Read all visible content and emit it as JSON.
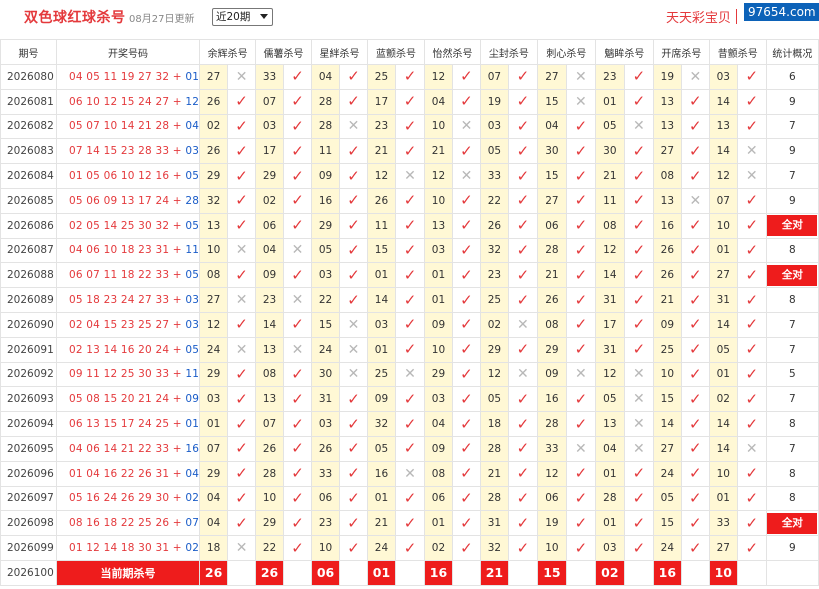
{
  "header": {
    "title": "双色球红球杀号",
    "updated": "08月27日更新",
    "range_select": "近20期",
    "brand": "天天彩宝贝",
    "watermark": "97654.com"
  },
  "table": {
    "columns": [
      "期号",
      "开奖号码",
      "余辉杀号",
      "儒薯杀号",
      "星絆杀号",
      "蓝颤杀号",
      "怡然杀号",
      "尘封杀号",
      "刺心杀号",
      "魑眸杀号",
      "开席杀号",
      "昔颤杀号",
      "统计概况"
    ],
    "rows": [
      {
        "period": "2026080",
        "red": "04 05 11 19 27 32",
        "blue": "01",
        "kills": [
          [
            "27",
            "x"
          ],
          [
            "33",
            "v"
          ],
          [
            "04",
            "v"
          ],
          [
            "25",
            "v"
          ],
          [
            "12",
            "v"
          ],
          [
            "07",
            "v"
          ],
          [
            "27",
            "x"
          ],
          [
            "23",
            "v"
          ],
          [
            "19",
            "x"
          ],
          [
            "03",
            "v"
          ]
        ],
        "stat": "6"
      },
      {
        "period": "2026081",
        "red": "06 10 12 15 24 27",
        "blue": "12",
        "kills": [
          [
            "26",
            "v"
          ],
          [
            "07",
            "v"
          ],
          [
            "28",
            "v"
          ],
          [
            "17",
            "v"
          ],
          [
            "04",
            "v"
          ],
          [
            "19",
            "v"
          ],
          [
            "15",
            "x"
          ],
          [
            "01",
            "v"
          ],
          [
            "13",
            "v"
          ],
          [
            "14",
            "v"
          ]
        ],
        "stat": "9"
      },
      {
        "period": "2026082",
        "red": "05 07 10 14 21 28",
        "blue": "04",
        "kills": [
          [
            "02",
            "v"
          ],
          [
            "03",
            "v"
          ],
          [
            "28",
            "x"
          ],
          [
            "23",
            "v"
          ],
          [
            "10",
            "x"
          ],
          [
            "03",
            "v"
          ],
          [
            "04",
            "v"
          ],
          [
            "05",
            "x"
          ],
          [
            "13",
            "v"
          ],
          [
            "13",
            "v"
          ]
        ],
        "stat": "7"
      },
      {
        "period": "2026083",
        "red": "07 14 15 23 28 33",
        "blue": "03",
        "kills": [
          [
            "26",
            "v"
          ],
          [
            "17",
            "v"
          ],
          [
            "11",
            "v"
          ],
          [
            "21",
            "v"
          ],
          [
            "21",
            "v"
          ],
          [
            "05",
            "v"
          ],
          [
            "30",
            "v"
          ],
          [
            "30",
            "v"
          ],
          [
            "27",
            "v"
          ],
          [
            "14",
            "x"
          ]
        ],
        "stat": "9"
      },
      {
        "period": "2026084",
        "red": "01 05 06 10 12 16",
        "blue": "05",
        "kills": [
          [
            "29",
            "v"
          ],
          [
            "29",
            "v"
          ],
          [
            "09",
            "v"
          ],
          [
            "12",
            "x"
          ],
          [
            "12",
            "x"
          ],
          [
            "33",
            "v"
          ],
          [
            "15",
            "v"
          ],
          [
            "21",
            "v"
          ],
          [
            "08",
            "v"
          ],
          [
            "12",
            "x"
          ]
        ],
        "stat": "7"
      },
      {
        "period": "2026085",
        "red": "05 06 09 13 17 24",
        "blue": "28",
        "kills": [
          [
            "32",
            "v"
          ],
          [
            "02",
            "v"
          ],
          [
            "16",
            "v"
          ],
          [
            "26",
            "v"
          ],
          [
            "10",
            "v"
          ],
          [
            "22",
            "v"
          ],
          [
            "27",
            "v"
          ],
          [
            "11",
            "v"
          ],
          [
            "13",
            "x"
          ],
          [
            "07",
            "v"
          ]
        ],
        "stat": "9"
      },
      {
        "period": "2026086",
        "red": "02 05 14 25 30 32",
        "blue": "05",
        "kills": [
          [
            "13",
            "v"
          ],
          [
            "06",
            "v"
          ],
          [
            "29",
            "v"
          ],
          [
            "11",
            "v"
          ],
          [
            "13",
            "v"
          ],
          [
            "26",
            "v"
          ],
          [
            "06",
            "v"
          ],
          [
            "08",
            "v"
          ],
          [
            "16",
            "v"
          ],
          [
            "10",
            "v"
          ]
        ],
        "stat": "全对"
      },
      {
        "period": "2026087",
        "red": "04 06 10 18 23 31",
        "blue": "11",
        "kills": [
          [
            "10",
            "x"
          ],
          [
            "04",
            "x"
          ],
          [
            "05",
            "v"
          ],
          [
            "15",
            "v"
          ],
          [
            "03",
            "v"
          ],
          [
            "32",
            "v"
          ],
          [
            "28",
            "v"
          ],
          [
            "12",
            "v"
          ],
          [
            "26",
            "v"
          ],
          [
            "01",
            "v"
          ]
        ],
        "stat": "8"
      },
      {
        "period": "2026088",
        "red": "06 07 11 18 22 33",
        "blue": "05",
        "kills": [
          [
            "08",
            "v"
          ],
          [
            "09",
            "v"
          ],
          [
            "03",
            "v"
          ],
          [
            "01",
            "v"
          ],
          [
            "01",
            "v"
          ],
          [
            "23",
            "v"
          ],
          [
            "21",
            "v"
          ],
          [
            "14",
            "v"
          ],
          [
            "26",
            "v"
          ],
          [
            "27",
            "v"
          ]
        ],
        "stat": "全对"
      },
      {
        "period": "2026089",
        "red": "05 18 23 24 27 33",
        "blue": "03",
        "kills": [
          [
            "27",
            "x"
          ],
          [
            "23",
            "x"
          ],
          [
            "22",
            "v"
          ],
          [
            "14",
            "v"
          ],
          [
            "01",
            "v"
          ],
          [
            "25",
            "v"
          ],
          [
            "26",
            "v"
          ],
          [
            "31",
            "v"
          ],
          [
            "21",
            "v"
          ],
          [
            "31",
            "v"
          ]
        ],
        "stat": "8"
      },
      {
        "period": "2026090",
        "red": "02 04 15 23 25 27",
        "blue": "03",
        "kills": [
          [
            "12",
            "v"
          ],
          [
            "14",
            "v"
          ],
          [
            "15",
            "x"
          ],
          [
            "03",
            "v"
          ],
          [
            "09",
            "v"
          ],
          [
            "02",
            "x"
          ],
          [
            "08",
            "v"
          ],
          [
            "17",
            "v"
          ],
          [
            "09",
            "v"
          ],
          [
            "14",
            "v"
          ]
        ],
        "stat": "7"
      },
      {
        "period": "2026091",
        "red": "02 13 14 16 20 24",
        "blue": "05",
        "kills": [
          [
            "24",
            "x"
          ],
          [
            "13",
            "x"
          ],
          [
            "24",
            "x"
          ],
          [
            "01",
            "v"
          ],
          [
            "10",
            "v"
          ],
          [
            "29",
            "v"
          ],
          [
            "29",
            "v"
          ],
          [
            "31",
            "v"
          ],
          [
            "25",
            "v"
          ],
          [
            "05",
            "v"
          ]
        ],
        "stat": "7"
      },
      {
        "period": "2026092",
        "red": "09 11 12 25 30 33",
        "blue": "11",
        "kills": [
          [
            "29",
            "v"
          ],
          [
            "08",
            "v"
          ],
          [
            "30",
            "x"
          ],
          [
            "25",
            "x"
          ],
          [
            "29",
            "v"
          ],
          [
            "12",
            "x"
          ],
          [
            "09",
            "x"
          ],
          [
            "12",
            "x"
          ],
          [
            "10",
            "v"
          ],
          [
            "01",
            "v"
          ]
        ],
        "stat": "5"
      },
      {
        "period": "2026093",
        "red": "05 08 15 20 21 24",
        "blue": "09",
        "kills": [
          [
            "03",
            "v"
          ],
          [
            "13",
            "v"
          ],
          [
            "31",
            "v"
          ],
          [
            "09",
            "v"
          ],
          [
            "03",
            "v"
          ],
          [
            "05",
            "v"
          ],
          [
            "16",
            "v"
          ],
          [
            "05",
            "x"
          ],
          [
            "15",
            "v"
          ],
          [
            "02",
            "v"
          ]
        ],
        "stat": "7"
      },
      {
        "period": "2026094",
        "red": "06 13 15 17 24 25",
        "blue": "01",
        "kills": [
          [
            "01",
            "v"
          ],
          [
            "07",
            "v"
          ],
          [
            "03",
            "v"
          ],
          [
            "32",
            "v"
          ],
          [
            "04",
            "v"
          ],
          [
            "18",
            "v"
          ],
          [
            "28",
            "v"
          ],
          [
            "13",
            "x"
          ],
          [
            "14",
            "v"
          ],
          [
            "14",
            "v"
          ]
        ],
        "stat": "8"
      },
      {
        "period": "2026095",
        "red": "04 06 14 21 22 33",
        "blue": "16",
        "kills": [
          [
            "07",
            "v"
          ],
          [
            "26",
            "v"
          ],
          [
            "26",
            "v"
          ],
          [
            "05",
            "v"
          ],
          [
            "09",
            "v"
          ],
          [
            "28",
            "v"
          ],
          [
            "33",
            "x"
          ],
          [
            "04",
            "x"
          ],
          [
            "27",
            "v"
          ],
          [
            "14",
            "x"
          ]
        ],
        "stat": "7"
      },
      {
        "period": "2026096",
        "red": "01 04 16 22 26 31",
        "blue": "04",
        "kills": [
          [
            "29",
            "v"
          ],
          [
            "28",
            "v"
          ],
          [
            "33",
            "v"
          ],
          [
            "16",
            "x"
          ],
          [
            "08",
            "v"
          ],
          [
            "21",
            "v"
          ],
          [
            "12",
            "v"
          ],
          [
            "01",
            "v"
          ],
          [
            "24",
            "v"
          ],
          [
            "10",
            "v"
          ]
        ],
        "stat": "8"
      },
      {
        "period": "2026097",
        "red": "05 16 24 26 29 30",
        "blue": "02",
        "kills": [
          [
            "04",
            "v"
          ],
          [
            "10",
            "v"
          ],
          [
            "06",
            "v"
          ],
          [
            "01",
            "v"
          ],
          [
            "06",
            "v"
          ],
          [
            "28",
            "v"
          ],
          [
            "06",
            "v"
          ],
          [
            "28",
            "v"
          ],
          [
            "05",
            "v"
          ],
          [
            "01",
            "v"
          ]
        ],
        "stat": "8"
      },
      {
        "period": "2026098",
        "red": "08 16 18 22 25 26",
        "blue": "07",
        "kills": [
          [
            "04",
            "v"
          ],
          [
            "29",
            "v"
          ],
          [
            "23",
            "v"
          ],
          [
            "21",
            "v"
          ],
          [
            "01",
            "v"
          ],
          [
            "31",
            "v"
          ],
          [
            "19",
            "v"
          ],
          [
            "01",
            "v"
          ],
          [
            "15",
            "v"
          ],
          [
            "33",
            "v"
          ]
        ],
        "stat": "全对"
      },
      {
        "period": "2026099",
        "red": "01 12 14 18 30 31",
        "blue": "02",
        "kills": [
          [
            "18",
            "x"
          ],
          [
            "22",
            "v"
          ],
          [
            "10",
            "v"
          ],
          [
            "24",
            "v"
          ],
          [
            "02",
            "v"
          ],
          [
            "32",
            "v"
          ],
          [
            "10",
            "v"
          ],
          [
            "03",
            "v"
          ],
          [
            "24",
            "v"
          ],
          [
            "27",
            "v"
          ]
        ],
        "stat": "9"
      }
    ],
    "current": {
      "period": "2026100",
      "label": "当前期杀号",
      "kills": [
        "26",
        "26",
        "06",
        "01",
        "16",
        "21",
        "15",
        "02",
        "16",
        "10"
      ]
    }
  },
  "icons": {
    "correct": "check-icon",
    "wrong": "cross-icon"
  },
  "colors": {
    "accent_red": "#e4393c",
    "highlight_yellow": "#fff8d5",
    "blue_ball": "#1a5cc8",
    "badge_red": "#ee1c1c"
  }
}
